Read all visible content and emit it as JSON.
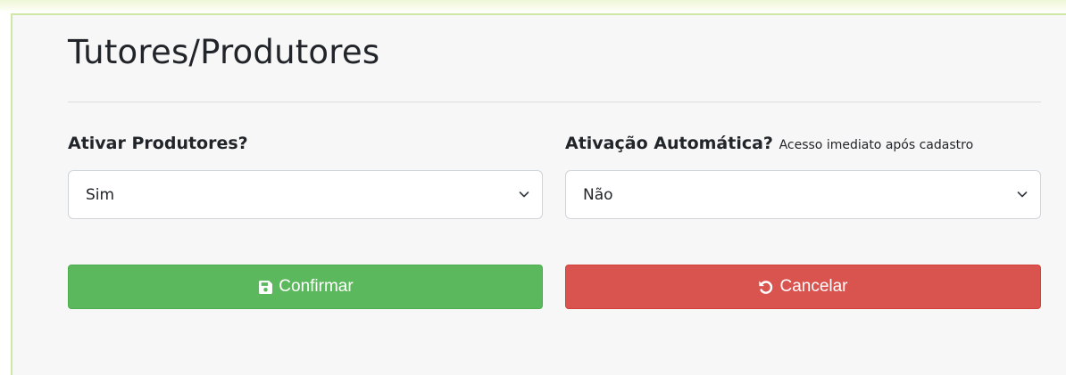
{
  "page": {
    "title": "Tutores/Produtores"
  },
  "fields": {
    "ativar_produtores": {
      "label": "Ativar Produtores?",
      "value": "Sim"
    },
    "ativacao_automatica": {
      "label": "Ativação Automática?",
      "hint": "Acesso imediato após cadastro",
      "value": "Não"
    }
  },
  "actions": {
    "confirm_label": "Confirmar",
    "cancel_label": "Cancelar"
  },
  "icons": {
    "confirm": "floppy-disk-icon",
    "cancel": "undo-icon",
    "select": "chevron-down-icon"
  },
  "colors": {
    "confirm": "#5cb85c",
    "cancel": "#d9534f"
  }
}
